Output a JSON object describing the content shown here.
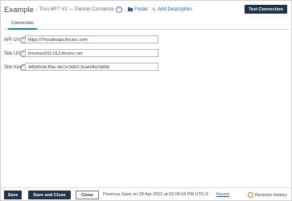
{
  "header": {
    "title": "Example",
    "subtitle": "- Thru MFT V2 — Partner Connector",
    "folder_link": "Folder",
    "add_description_link": "Add Description",
    "test_connection_button": "Test Connection"
  },
  "tabs": [
    {
      "label": "Connection",
      "active": true
    }
  ],
  "fields": {
    "api_url": {
      "label": "API Url",
      "value": "https://Thrudevapi.thruinc.com"
    },
    "site_url": {
      "label": "Site Url",
      "value": "thrurepo011-012.thruinc.net"
    },
    "site_key": {
      "label": "Site Key",
      "value": "445d0ctb-f0ac-4e7a-9d23-3cae04a7a60b"
    }
  },
  "footer": {
    "save_button": "Save",
    "save_and_close_button": "Save and Close",
    "close_button": "Close",
    "save_status": "Previous Save on 28 Apr 2021 at 02:05:54 PM UTC-5",
    "revert_link": "Revert",
    "revision_history_link": "Revision History"
  },
  "colors": {
    "primary_button": "#1f3349",
    "link": "#2a5aa0",
    "active_tab_underline": "#1e7bb3"
  },
  "icons": {
    "info": "info-icon",
    "folder": "folder-icon",
    "pencil": "pencil-icon",
    "history": "history-icon"
  }
}
